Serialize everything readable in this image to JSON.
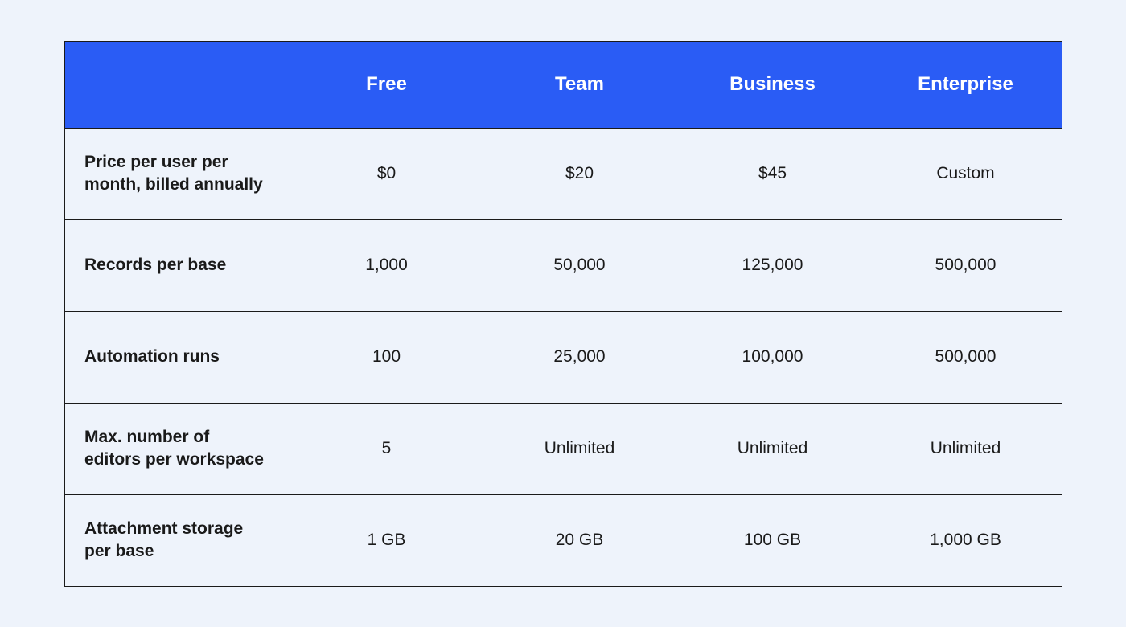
{
  "chart_data": {
    "type": "table",
    "title": "",
    "columns": [
      "Free",
      "Team",
      "Business",
      "Enterprise"
    ],
    "rows": [
      {
        "label": "Price per user per month, billed annually",
        "values": [
          "$0",
          "$20",
          "$45",
          "Custom"
        ]
      },
      {
        "label": "Records per base",
        "values": [
          "1,000",
          "50,000",
          "125,000",
          "500,000"
        ]
      },
      {
        "label": "Automation runs",
        "values": [
          "100",
          "25,000",
          "100,000",
          "500,000"
        ]
      },
      {
        "label": "Max. number of editors per workspace",
        "values": [
          "5",
          "Unlimited",
          "Unlimited",
          "Unlimited"
        ]
      },
      {
        "label": "Attachment storage per base",
        "values": [
          "1 GB",
          "20 GB",
          "100 GB",
          "1,000 GB"
        ]
      }
    ]
  }
}
